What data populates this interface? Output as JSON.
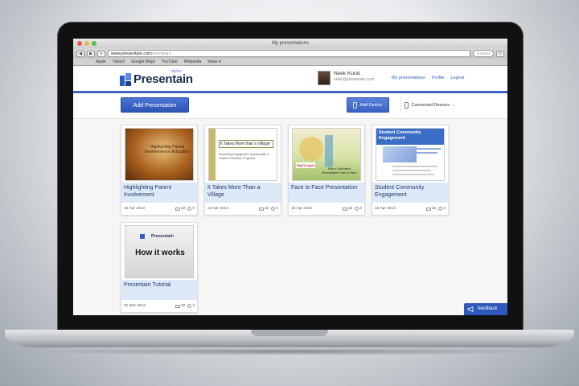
{
  "browser": {
    "window_title": "My presentations",
    "url_host": "www.presentain.com",
    "url_path": "/seminars",
    "search_placeholder": "Reader",
    "bookmarks": [
      "Apple",
      "Yahoo!",
      "Google Maps",
      "YouTube",
      "Wikipedia",
      "News ▾"
    ]
  },
  "header": {
    "logo_text": "Presentain",
    "logo_tag": "alpha",
    "user_name": "Neek Kurat",
    "user_email": "neek@presentain.com",
    "links": [
      "My presentations",
      "Profile",
      "Logout"
    ]
  },
  "actions": {
    "add_presentation": "Add Presentation",
    "add_device": "Add Device",
    "connected_devices": "Connected Devices"
  },
  "presentations": [
    {
      "title": "Highlighting Parent Involvement",
      "date": "15 Apr 2013",
      "slides": "32",
      "views": "0",
      "thumb_text": "Highlighting Parent Involvement in Education",
      "thumb_bg": "#8a4a12"
    },
    {
      "title": "It Takes More Than a Village",
      "date": "15 Apr 2013",
      "slides": "32",
      "views": "0",
      "thumb_text": "It Takes More than a Village:",
      "thumb_sub": "Expanding Engagement Opportunities in Teacher Education Programs",
      "thumb_bg": "#ffffff"
    },
    {
      "title": "Face to Face Presentation",
      "date": "15 Apr 2013",
      "slides": "32",
      "views": "0",
      "thumb_text": "Arts in Education Roundtable Face to Face",
      "thumb_brand": "BigThought",
      "thumb_bg": "#f0e9c8"
    },
    {
      "title": "Student Community Engagement",
      "date": "15 Apr 2013",
      "slides": "32",
      "views": "0",
      "thumb_text": "Student Community Engagement",
      "thumb_bg": "#3a6dc6"
    },
    {
      "title": "Presentain Tutorial",
      "date": "01 Mar 2013",
      "slides": "32",
      "views": "4",
      "thumb_text": "How it works",
      "thumb_brand": "Presentain",
      "thumb_bg": "#e6e6e6"
    }
  ],
  "feedback": {
    "label": "feedback"
  },
  "colors": {
    "accent": "#3c63c8",
    "card_title_bg": "#dde8f8",
    "title_text": "#1f3a6d"
  }
}
